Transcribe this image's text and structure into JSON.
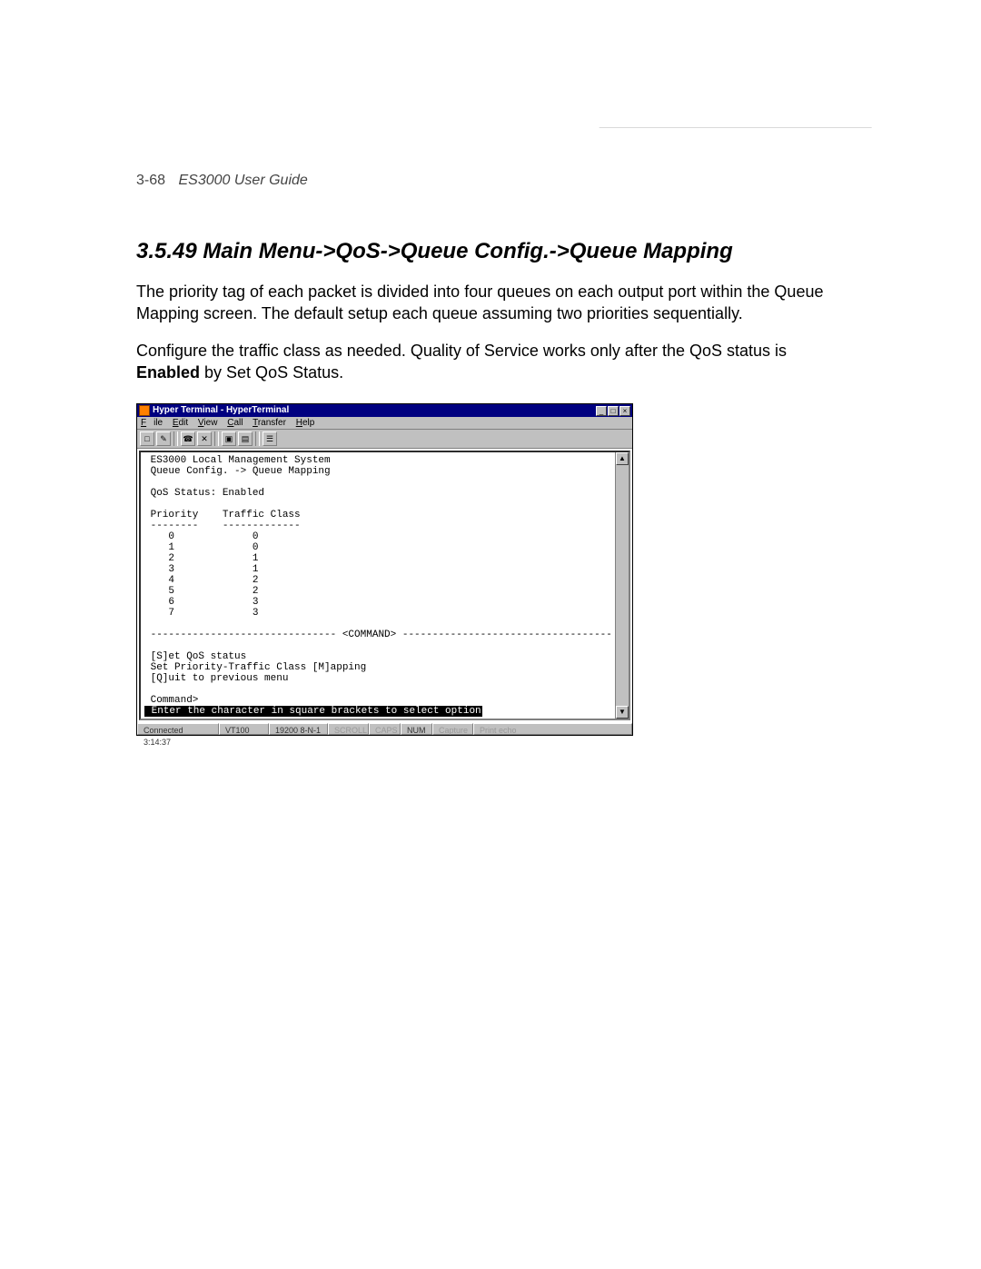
{
  "page_header": {
    "number": "3-68",
    "guide": "ES3000 User Guide"
  },
  "heading": "3.5.49  Main Menu->QoS->Queue Config.->Queue Mapping",
  "para1": "The priority tag of each packet is divided into four queues on each output port within the Queue Mapping screen. The default setup each queue assuming two priorities sequentially.",
  "para2_pre": "Configure the traffic class as needed. Quality of Service works only after the QoS status is ",
  "para2_bold": "Enabled",
  "para2_post": " by Set QoS Status.",
  "hyperterminal": {
    "title": "Hyper Terminal - HyperTerminal",
    "menus": [
      "File",
      "Edit",
      "View",
      "Call",
      "Transfer",
      "Help"
    ],
    "toolbar_icons": [
      "new-icon",
      "open-icon",
      "save-icon",
      "connect-icon",
      "disconnect-icon",
      "send-icon",
      "properties-icon"
    ],
    "window_buttons": {
      "min": "_",
      "max": "□",
      "close": "×"
    },
    "scroll": {
      "up": "▲",
      "down": "▼"
    },
    "terminal": {
      "line_system": " ES3000 Local Management System",
      "line_path": " Queue Config. -> Queue Mapping",
      "blank": "",
      "qos_status": " QoS Status: Enabled",
      "hdr_priority": " Priority    Traffic Class",
      "hdr_dash": " --------    -------------",
      "rows": [
        "    0             0",
        "    1             0",
        "    2             1",
        "    3             1",
        "    4             2",
        "    5             2",
        "    6             3",
        "    7             3"
      ],
      "cmd_divider": " ------------------------------- <COMMAND> -----------------------------------",
      "cmd_set": " [S]et QoS status",
      "cmd_map": " Set Priority-Traffic Class [M]apping",
      "cmd_quit": " [Q]uit to previous menu",
      "cmd_prompt": " Command>",
      "bottom_hint": " Enter the character in square brackets to select option"
    },
    "statusbar": {
      "connected": "Connected 3:14:37",
      "emul": "VT100",
      "line": "19200 8-N-1",
      "scroll": "SCROLL",
      "caps": "CAPS",
      "num": "NUM",
      "capture": "Capture",
      "echo": "Print echo"
    }
  }
}
